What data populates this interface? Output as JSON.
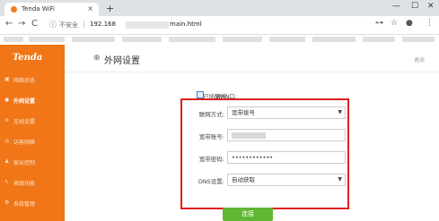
{
  "browser": {
    "tab_title": "Tenda WiFi",
    "tab_close": "×",
    "new_tab": "+",
    "window_controls": [
      "—",
      "☐",
      "✕"
    ],
    "nav": {
      "back": "←",
      "forward": "→",
      "reload": "C"
    },
    "security_label": "不安全",
    "url_host": "192.168",
    "url_path": "main.html",
    "toolbar_icons": [
      "⊶",
      "☆",
      "●",
      "⋮"
    ]
  },
  "sidebar": {
    "logo": "Tenda",
    "items": [
      {
        "icon": "▣",
        "label": "网络状态",
        "active": false
      },
      {
        "icon": "◉",
        "label": "外网设置",
        "active": true
      },
      {
        "icon": "≋",
        "label": "无线设置",
        "active": false
      },
      {
        "icon": "◎",
        "label": "访客网络",
        "active": false
      },
      {
        "icon": "♟",
        "label": "家长控制",
        "active": false
      },
      {
        "icon": "↖",
        "label": "高级功能",
        "active": false
      },
      {
        "icon": "⚙",
        "label": "系统管理",
        "active": false
      }
    ]
  },
  "content": {
    "title": "外网设置",
    "logout": "退出",
    "wan_label": "WAN口:",
    "wan_status": "已插网线",
    "form": [
      {
        "label": "联网方式:",
        "value": "宽带拨号",
        "type": "select"
      },
      {
        "label": "宽带账号:",
        "value": "",
        "type": "text-blurred"
      },
      {
        "label": "宽带密码:",
        "value": "••••••••••••",
        "type": "password"
      },
      {
        "label": "DNS设置:",
        "value": "自动获取",
        "type": "select"
      }
    ],
    "connect_button": "连接"
  }
}
